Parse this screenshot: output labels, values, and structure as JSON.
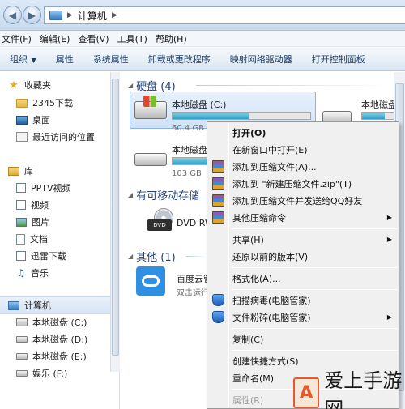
{
  "address": {
    "segment": "计算机"
  },
  "menu": [
    "文件(F)",
    "编辑(E)",
    "查看(V)",
    "工具(T)",
    "帮助(H)"
  ],
  "commands": [
    "组织",
    "属性",
    "系统属性",
    "卸载或更改程序",
    "映射网络驱动器",
    "打开控制面板"
  ],
  "nav": {
    "favorites": {
      "label": "收藏夹",
      "items": [
        "2345下载",
        "桌面",
        "最近访问的位置"
      ]
    },
    "libraries": {
      "label": "库",
      "items": [
        "PPTV视频",
        "视频",
        "图片",
        "文档",
        "迅雷下载",
        "音乐"
      ]
    },
    "computer": {
      "label": "计算机",
      "items": [
        "本地磁盘 (C:)",
        "本地磁盘 (D:)",
        "本地磁盘 (E:)",
        "娱乐 (F:)"
      ]
    }
  },
  "content": {
    "hard_disks": {
      "header": "硬盘 (4)",
      "drives": [
        {
          "name": "本地磁盘 (C:)",
          "size_text": "60.4 GB",
          "usage": 0.55
        },
        {
          "name": "本地磁盘",
          "size_text": "",
          "usage": 0.6
        },
        {
          "name": "本地磁盘",
          "size_text": "103 GB",
          "usage": 0.25
        }
      ]
    },
    "removable": {
      "header": "有可移动存储",
      "dvd_name": "DVD RW",
      "dvd_badge": "DVD"
    },
    "other": {
      "header": "其他 (1)",
      "baidu_name": "百度云管",
      "baidu_desc": "双击运行"
    }
  },
  "context_menu": {
    "items": [
      {
        "label": "打开(O)",
        "bold": true,
        "icon": "",
        "submenu": false
      },
      {
        "label": "在新窗口中打开(E)",
        "icon": "",
        "submenu": false
      },
      {
        "label": "添加到压缩文件(A)...",
        "icon": "winrar-icon",
        "submenu": false
      },
      {
        "label": "添加到 \"新建压缩文件.zip\"(T)",
        "icon": "winrar-icon",
        "submenu": false
      },
      {
        "label": "添加到压缩文件并发送给QQ好友",
        "icon": "winrar-icon",
        "submenu": false
      },
      {
        "label": "其他压缩命令",
        "icon": "winrar-icon",
        "submenu": true
      },
      {
        "label": "共享(H)",
        "icon": "",
        "submenu": true
      },
      {
        "label": "还原以前的版本(V)",
        "icon": "",
        "submenu": false
      },
      {
        "label": "格式化(A)...",
        "icon": "",
        "submenu": false
      },
      {
        "label": "扫描病毒(电脑管家)",
        "icon": "shield-icon",
        "submenu": false
      },
      {
        "label": "文件粉碎(电脑管家)",
        "icon": "shield-icon",
        "submenu": true
      },
      {
        "label": "复制(C)",
        "icon": "",
        "submenu": false
      },
      {
        "label": "创建快捷方式(S)",
        "icon": "",
        "submenu": false
      },
      {
        "label": "重命名(M)",
        "icon": "",
        "submenu": false
      },
      {
        "label": "属性(R)",
        "icon": "",
        "submenu": false,
        "disabled": true
      }
    ]
  },
  "watermark": {
    "text": "爱上手游网",
    "logo_char": "A"
  },
  "colors": {
    "accent": "#2f9fc8",
    "group_header": "#1e3f7a",
    "brand": "#e35b2c"
  }
}
